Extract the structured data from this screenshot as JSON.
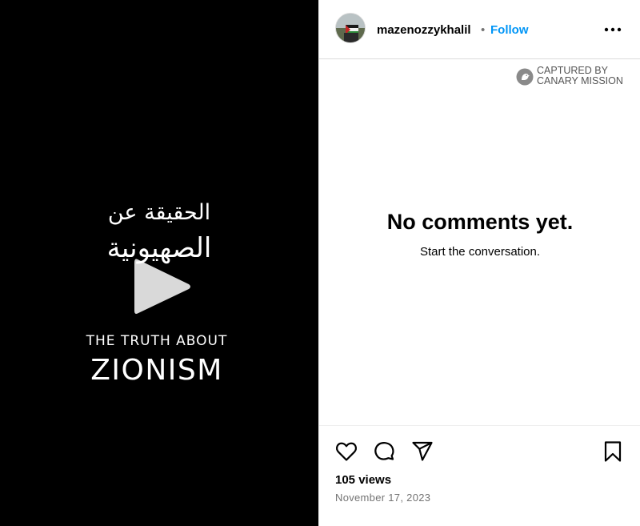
{
  "video": {
    "arabic_title_line1": "الحقيقة عن",
    "arabic_title_line2": "الصهيونية",
    "english_title_line1": "THE TRUTH ABOUT",
    "english_title_line2": "ZIONISM",
    "play_icon": "play-icon",
    "background_color": "#000000"
  },
  "header": {
    "username": "mazenozzykhalil",
    "separator": "•",
    "follow_label": "Follow",
    "more_icon": "more-horizontal-icon",
    "accent_color": "#0095f6"
  },
  "watermark": {
    "line1": "CAPTURED BY",
    "line2": "CANARY MISSION",
    "icon": "canary-bird-icon"
  },
  "comments": {
    "empty_title": "No comments yet.",
    "empty_subtitle": "Start the conversation."
  },
  "footer": {
    "icons": [
      "heart-icon",
      "comment-icon",
      "share-icon",
      "bookmark-icon"
    ],
    "views": "105 views",
    "date": "November 17, 2023"
  }
}
